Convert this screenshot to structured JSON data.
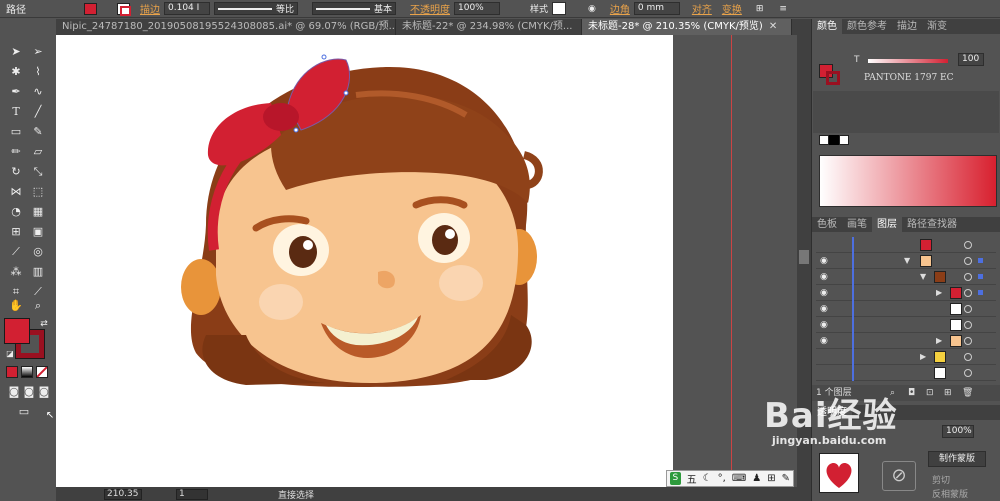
{
  "control_bar": {
    "mode_label": "路径",
    "stroke_label": "描边",
    "stroke_value": "0.104 I",
    "profile_label": "等比",
    "brush_label": "基本",
    "opacity_label": "不透明度",
    "opacity_value": "100%",
    "style_label": "样式",
    "corner_label": "边角",
    "corner_value": "0 mm",
    "align_label": "对齐",
    "transform_label": "变换"
  },
  "tabs": [
    {
      "label": "Nipic_24787180_20190508195524308085.ai* @ 69.07% (RGB/预...",
      "active": false
    },
    {
      "label": "未标题-22* @ 234.98% (CMYK/预...",
      "active": false
    },
    {
      "label": "未标题-28* @ 210.35% (CMYK/预览)",
      "active": true
    }
  ],
  "status": {
    "zoom": "210.35",
    "page": "1",
    "tool": "直接选择"
  },
  "color_panel": {
    "tabs": [
      "颜色",
      "颜色参考",
      "描边",
      "渐变"
    ],
    "tint_label": "T",
    "tint_value": "100",
    "pantone": "PANTONE 1797 EC",
    "fill_color": "#d22032"
  },
  "layers_panel": {
    "tabs": [
      "色板",
      "画笔",
      "图层",
      "路径查找器"
    ],
    "count_label": "1 个图层",
    "accent": "#4d6fe0"
  },
  "bottom_panel": {
    "title": "透明度",
    "opacity_value": "100%",
    "make_mask_label": "制作蒙版",
    "clip_label": "剪切",
    "invert_label": "反相蒙版"
  },
  "ime": {
    "label": "五"
  },
  "watermark": {
    "brand": "Bai经验",
    "url": "jingyan.baidu.com"
  }
}
